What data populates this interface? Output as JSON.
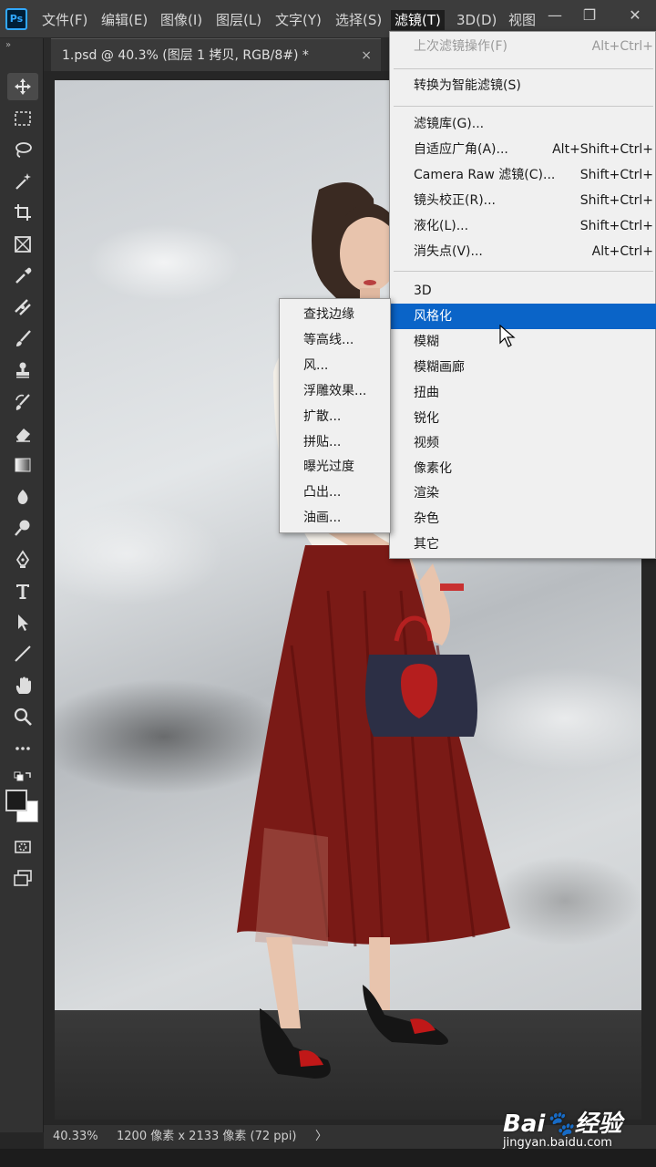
{
  "app": {
    "logo": "Ps"
  },
  "menubar": {
    "items": [
      "文件(F)",
      "编辑(E)",
      "图像(I)",
      "图层(L)",
      "文字(Y)",
      "选择(S)",
      "滤镜(T)",
      "3D(D)",
      "视图"
    ],
    "active_index": 6,
    "controls": {
      "minimize": "—",
      "restore": "❐",
      "close": "✕"
    }
  },
  "document": {
    "tab_title": "1.psd @ 40.3% (图层 1 拷贝, RGB/8#) *",
    "close_glyph": "×"
  },
  "toolbar": {
    "collapse": "»",
    "tools": [
      "move-tool",
      "marquee-tool",
      "lasso-tool",
      "magic-wand-tool",
      "crop-tool",
      "frame-tool",
      "eyedropper-tool",
      "healing-brush-tool",
      "brush-tool",
      "clone-stamp-tool",
      "history-brush-tool",
      "eraser-tool",
      "gradient-tool",
      "blur-tool",
      "dodge-tool",
      "pen-tool",
      "type-tool",
      "path-selection-tool",
      "line-tool",
      "hand-tool",
      "zoom-tool",
      "more-tools",
      "swap-colors",
      "color-swatches",
      "quick-mask",
      "screen-mode"
    ],
    "colors": {
      "foreground": "#1c1c1c",
      "background": "#ffffff"
    }
  },
  "filter_menu": {
    "items": [
      {
        "label": "上次滤镜操作(F)",
        "shortcut": "Alt+Ctrl+",
        "disabled": true
      },
      {
        "label": "转换为智能滤镜(S)",
        "shortcut": ""
      },
      {
        "label": "滤镜库(G)...",
        "shortcut": ""
      },
      {
        "label": "自适应广角(A)...",
        "shortcut": "Alt+Shift+Ctrl+"
      },
      {
        "label": "Camera Raw 滤镜(C)...",
        "shortcut": "Shift+Ctrl+"
      },
      {
        "label": "镜头校正(R)...",
        "shortcut": "Shift+Ctrl+"
      },
      {
        "label": "液化(L)...",
        "shortcut": "Shift+Ctrl+"
      },
      {
        "label": "消失点(V)...",
        "shortcut": "Alt+Ctrl+"
      },
      {
        "label": "3D",
        "shortcut": ""
      },
      {
        "label": "风格化",
        "shortcut": "",
        "highlighted": true
      },
      {
        "label": "模糊",
        "shortcut": ""
      },
      {
        "label": "模糊画廊",
        "shortcut": ""
      },
      {
        "label": "扭曲",
        "shortcut": ""
      },
      {
        "label": "锐化",
        "shortcut": ""
      },
      {
        "label": "视频",
        "shortcut": ""
      },
      {
        "label": "像素化",
        "shortcut": ""
      },
      {
        "label": "渲染",
        "shortcut": ""
      },
      {
        "label": "杂色",
        "shortcut": ""
      },
      {
        "label": "其它",
        "shortcut": ""
      }
    ],
    "highlight_color": "#0a64c8"
  },
  "stylize_submenu": {
    "items": [
      "查找边缘",
      "等高线...",
      "风...",
      "浮雕效果...",
      "扩散...",
      "拼贴...",
      "曝光过度",
      "凸出...",
      "油画..."
    ]
  },
  "statusbar": {
    "zoom": "40.33%",
    "doc_info": "1200 像素 x 2133 像素 (72 ppi)",
    "arrow": "〉"
  },
  "watermark": {
    "logo": "Bai🐾经验",
    "url": "jingyan.baidu.com"
  }
}
